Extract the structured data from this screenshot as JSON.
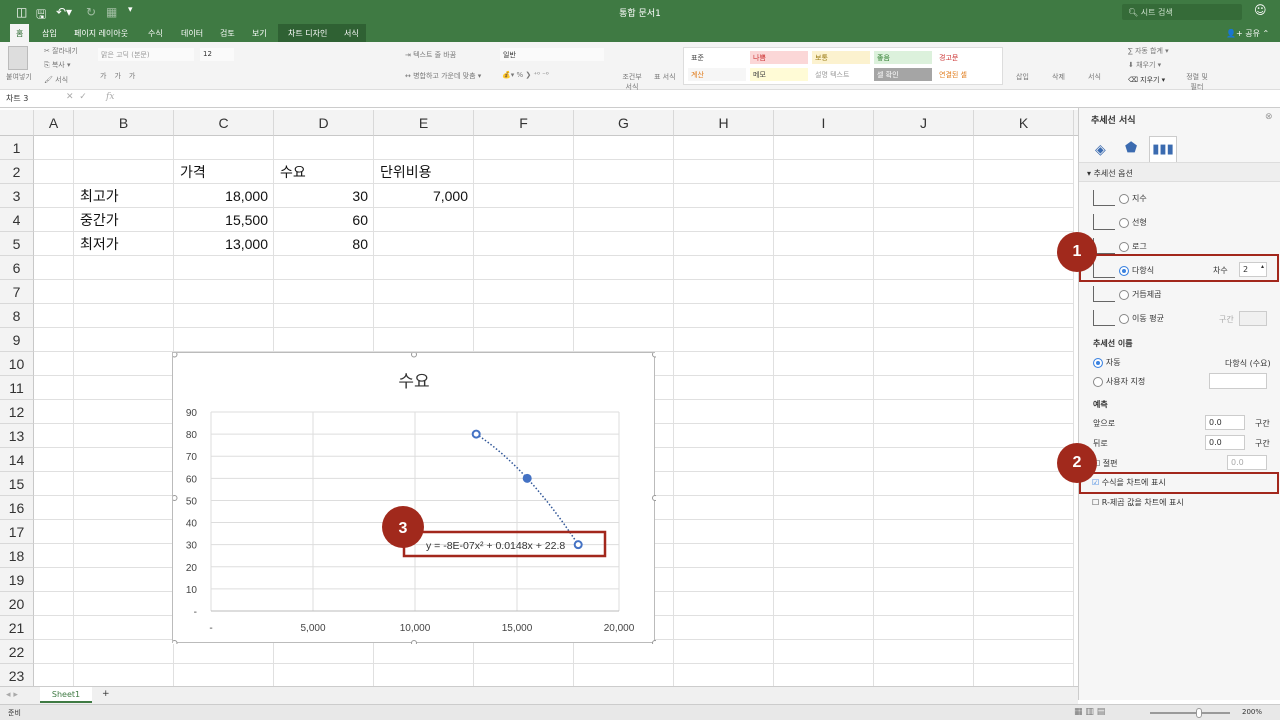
{
  "app": {
    "title": "통합 문서1",
    "search_placeholder": "시트 검색",
    "share": "공유"
  },
  "tabs": [
    {
      "label": "홈",
      "active": true
    },
    {
      "label": "삽입"
    },
    {
      "label": "페이지 레이아웃"
    },
    {
      "label": "수식"
    },
    {
      "label": "데이터"
    },
    {
      "label": "검토"
    },
    {
      "label": "보기"
    },
    {
      "label": "차트 디자인",
      "contextual": true
    },
    {
      "label": "서식",
      "contextual": true
    }
  ],
  "ribbon": {
    "paste": "붙여넣기",
    "cut": "잘라내기",
    "copy": "복사",
    "format_painter": "서식",
    "font": "맑은 고딕 (본문)",
    "size": "12",
    "wrap": "텍스트 줄 바꿈",
    "merge": "병합하고 가운데 맞춤",
    "numfmt": "일반",
    "cond": "조건부 서식",
    "table": "표 서식",
    "styles": [
      "표준",
      "나쁨",
      "보통",
      "좋음",
      "경고문",
      "계산",
      "메모",
      "설명 텍스트",
      "셀 확인",
      "연결된 셀"
    ],
    "insert": "삽입",
    "delete": "삭제",
    "format": "서식",
    "autosum": "자동 합계",
    "fill": "채우기",
    "clear": "지우기",
    "sort": "정렬 및 필터"
  },
  "formula_bar": {
    "name_box": "차트 3",
    "fx": "fx",
    "value": ""
  },
  "columns": [
    "A",
    "B",
    "C",
    "D",
    "E",
    "F",
    "G",
    "H",
    "I",
    "J",
    "K"
  ],
  "rows": [
    "1",
    "2",
    "3",
    "4",
    "5",
    "6",
    "7",
    "8",
    "9",
    "10",
    "11",
    "12",
    "13",
    "14",
    "15",
    "16",
    "17",
    "18",
    "19",
    "20",
    "21",
    "22",
    "23"
  ],
  "cells": {
    "C2": "가격",
    "D2": "수요",
    "E2": "단위비용",
    "B3": "최고가",
    "C3": "18,000",
    "D3": "30",
    "E3": "7,000",
    "B4": "중간가",
    "C4": "15,500",
    "D4": "60",
    "B5": "최저가",
    "C5": "13,000",
    "D5": "80"
  },
  "chart_data": {
    "type": "scatter",
    "title": "수요",
    "x": [
      18000,
      15500,
      13000
    ],
    "y": [
      30,
      60,
      80
    ],
    "xlim": [
      0,
      20000
    ],
    "ylim": [
      0,
      90
    ],
    "xticks": [
      "-",
      "5,000",
      "10,000",
      "15,000",
      "20,000"
    ],
    "yticks": [
      "-",
      "10",
      "20",
      "30",
      "40",
      "50",
      "60",
      "70",
      "80",
      "90"
    ],
    "grid": true,
    "trendline": {
      "type": "polynomial",
      "order": 2,
      "style": "dotted",
      "equation": "y = -8E-07x² + 0.0148x + 22.8"
    },
    "color": "#4472c4"
  },
  "pane": {
    "title": "추세선 서식",
    "section": "추세선 옵션",
    "types": [
      {
        "label": "지수"
      },
      {
        "label": "선형"
      },
      {
        "label": "로그"
      },
      {
        "label": "다항식",
        "selected": true
      },
      {
        "label": "거듭제곱"
      },
      {
        "label": "이동 평균"
      }
    ],
    "order_label": "차수",
    "order_value": "2",
    "period_label": "구간",
    "name_heading": "추세선 이름",
    "auto": "자동",
    "auto_value": "다항식 (수요)",
    "custom": "사용자 지정",
    "forecast": "예측",
    "forward": "앞으로",
    "forward_value": "0.0",
    "backward": "뒤로",
    "backward_value": "0.0",
    "unit": "구간",
    "intercept": "절편",
    "intercept_value": "0.0",
    "show_eq": "수식을 차트에 표시",
    "show_eq_checked": true,
    "show_r2": "R-제곱 값을 차트에 표시",
    "show_r2_checked": false
  },
  "callouts": [
    "1",
    "2",
    "3"
  ],
  "sheet": {
    "name": "Sheet1",
    "add": "+"
  },
  "status": {
    "ready": "준비",
    "zoom": "200%"
  },
  "colors": {
    "excel_green": "#3f7a43",
    "callout": "#a1291c",
    "series": "#4472c4"
  }
}
